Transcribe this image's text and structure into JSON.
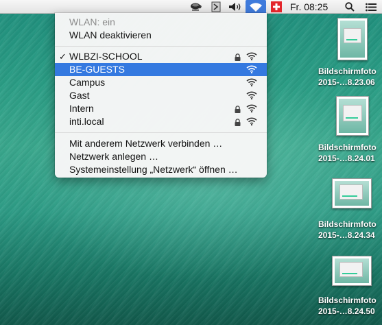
{
  "menubar": {
    "clock": "Fr. 08:25",
    "icons": [
      "coffee-cup-icon",
      "document-sync-icon",
      "volume-icon",
      "wifi-icon",
      "swiss-flag-icon",
      "spotlight-search-icon",
      "notification-list-icon"
    ]
  },
  "wifi_menu": {
    "status": "WLAN: ein",
    "toggle_label": "WLAN deaktivieren",
    "networks": [
      {
        "name": "WLBZI-SCHOOL",
        "connected": true,
        "secured": true
      },
      {
        "name": "BE-GUESTS",
        "highlighted": true,
        "secured": false
      },
      {
        "name": "Campus",
        "secured": false
      },
      {
        "name": "Gast",
        "secured": false
      },
      {
        "name": "Intern",
        "secured": true
      },
      {
        "name": "inti.local",
        "secured": true
      }
    ],
    "actions": [
      "Mit anderem Netzwerk verbinden …",
      "Netzwerk anlegen …",
      "Systemeinstellung „Netzwerk“ öffnen …"
    ],
    "accent_color": "#3479e0"
  },
  "desktop": {
    "files": [
      {
        "line1": "Bildschirmfoto",
        "line2": "2015-…8.23.06"
      },
      {
        "line1": "Bildschirmfoto",
        "line2": "2015-…8.24.01"
      },
      {
        "line1": "Bildschirmfoto",
        "line2": "2015-…8.24.34"
      },
      {
        "line1": "Bildschirmfoto",
        "line2": "2015-…8.24.50"
      }
    ]
  }
}
